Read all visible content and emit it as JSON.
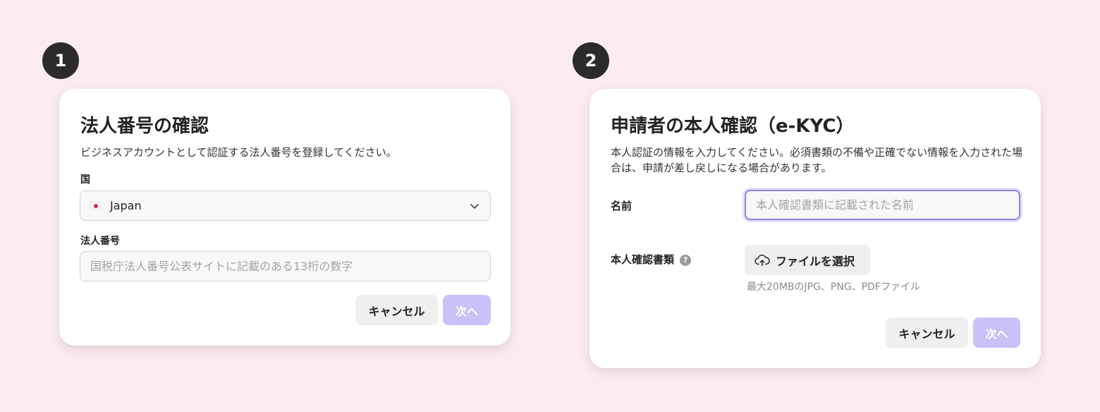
{
  "step1": {
    "badge": "1",
    "title": "法人番号の確認",
    "description": "ビジネスアカウントとして認証する法人番号を登録してください。",
    "country_label": "国",
    "country_value": "Japan",
    "corp_number_label": "法人番号",
    "corp_number_placeholder": "国税庁法人番号公表サイトに記載のある13桁の数字",
    "cancel_label": "キャンセル",
    "next_label": "次へ"
  },
  "step2": {
    "badge": "2",
    "title": "申請者の本人確認（e-KYC）",
    "description": "本人認証の情報を入力してください。必須書類の不備や正確でない情報を入力された場合は、申請が差し戻しになる場合があります。",
    "name_label": "名前",
    "name_placeholder": "本人確認書類に記載された名前",
    "id_doc_label": "本人確認書類",
    "help_icon_glyph": "?",
    "upload_label": "ファイルを選択",
    "upload_hint": "最大20MBのJPG、PNG、PDFファイル",
    "cancel_label": "キャンセル",
    "next_label": "次へ"
  },
  "colors": {
    "page_background": "#fdecef",
    "badge_background": "#2b2b2b",
    "next_button_disabled": "#c9c2f7",
    "focus_ring": "#8c82ea"
  },
  "icons": {
    "flag": "japan-flag-icon",
    "chevron": "chevron-down-icon",
    "upload": "cloud-upload-icon",
    "help": "help-circle-icon"
  }
}
